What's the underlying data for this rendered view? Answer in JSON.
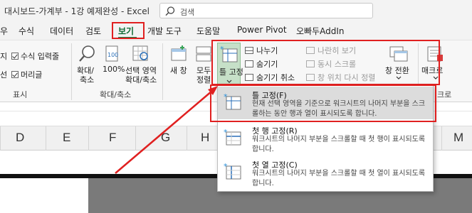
{
  "title_bar": {
    "title": "대시보드-가계부 - 1강 예제완성 - Excel",
    "search_placeholder": "검색"
  },
  "tabs": [
    {
      "label": "우",
      "active": false
    },
    {
      "label": "수식",
      "active": false
    },
    {
      "label": "데이터",
      "active": false
    },
    {
      "label": "검토",
      "active": false
    },
    {
      "label": "보기",
      "active": true
    },
    {
      "label": "개발 도구",
      "active": false
    },
    {
      "label": "도움말",
      "active": false
    },
    {
      "label": "Power Pivot",
      "active": false
    },
    {
      "label": "오빠두AddIn",
      "active": false
    }
  ],
  "ribbon": {
    "show_group": {
      "formula_bar": "수식 입력줄",
      "headings": "머리글",
      "prefix_1": "지",
      "prefix_2": "선",
      "label": "표시"
    },
    "zoom_group": {
      "zoom": "확대/",
      "zoom2": "축소",
      "hundred": "100%",
      "zoom_sel": "선택 영역",
      "zoom_sel2": "확대/축소",
      "label": "확대/축소"
    },
    "window_group": {
      "new_window": "새 창",
      "arrange": "모두",
      "arrange2": "정렬",
      "freeze": "틀 고정",
      "split": "나누기",
      "hide": "숨기기",
      "unhide": "숨기기 취소",
      "side_by_side": "나란히 보기",
      "sync_scroll": "동시 스크롤",
      "reset_position": "창 위치 다시 정렬",
      "switch_windows": "창 전환",
      "macros": "매크로",
      "macros_group": "크로"
    }
  },
  "columns": [
    "D",
    "E",
    "F",
    "G",
    "H",
    "M"
  ],
  "freeze_menu": [
    {
      "title": "틀 고정(F)",
      "desc": "현재 선택 영역을 기준으로 워크시트의 나머지 부분을 스크롤하는 동안 행과 열이 표시되도록 합니다.",
      "highlighted": true
    },
    {
      "title": "첫 행 고정(R)",
      "desc": "워크시트의 나머지 부분을 스크롤할 때 첫 행이 표시되도록 합니다.",
      "highlighted": false
    },
    {
      "title": "첫 열 고정(C)",
      "desc": "워크시트의 나머지 부분을 스크롤할 때 첫 열이 표시되도록 합니다.",
      "highlighted": false
    }
  ],
  "colors": {
    "accent": "#107c41",
    "highlight_red": "#e02020",
    "menu_highlight": "#dcdcdc"
  }
}
